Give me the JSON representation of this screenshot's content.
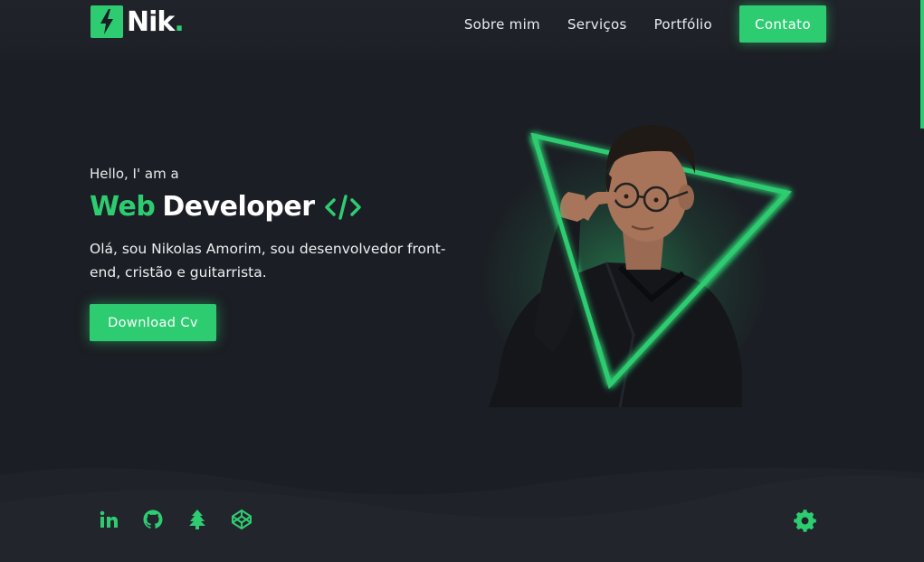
{
  "brand": {
    "name": "Nik",
    "dot": ".",
    "logo_icon": "lightning-bolt-icon"
  },
  "nav": {
    "links": [
      "Sobre mim",
      "Serviços",
      "Portfólio"
    ],
    "cta": "Contato"
  },
  "hero": {
    "greeting": "Hello, I' am a",
    "title_accent": "Web",
    "title_main": "Developer",
    "title_icon": "code-icon",
    "description": "Olá, sou Nikolas Amorim, sou desenvolvedor front-end, cristão e guitarrista.",
    "download_label": "Download Cv",
    "photo_icon": "portrait-photo"
  },
  "footer": {
    "socials": [
      "linkedin-icon",
      "github-icon",
      "linktree-icon",
      "codepen-icon"
    ],
    "settings_icon": "gear-icon"
  },
  "colors": {
    "accent": "#2ecc71",
    "background": "#1b1e24",
    "header": "#20232a",
    "text": "#e8eaec"
  }
}
